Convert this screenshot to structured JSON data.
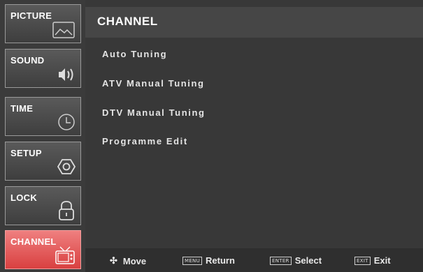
{
  "sidebar": {
    "tabs": [
      {
        "label": "PICTURE",
        "icon": "picture-icon",
        "active": false
      },
      {
        "label": "SOUND",
        "icon": "speaker-icon",
        "active": false
      },
      {
        "label": "TIME",
        "icon": "clock-icon",
        "active": false
      },
      {
        "label": "SETUP",
        "icon": "gear-icon",
        "active": false
      },
      {
        "label": "LOCK",
        "icon": "lock-icon",
        "active": false
      },
      {
        "label": "CHANNEL",
        "icon": "tv-icon",
        "active": true
      }
    ]
  },
  "main": {
    "title": "CHANNEL",
    "items": [
      {
        "label": "Auto Tuning"
      },
      {
        "label": "ATV Manual Tuning"
      },
      {
        "label": "DTV Manual Tuning"
      },
      {
        "label": "Programme Edit"
      }
    ]
  },
  "footer": {
    "move": {
      "label": "Move"
    },
    "return": {
      "key": "MENU",
      "label": "Return"
    },
    "select": {
      "key": "ENTER",
      "label": "Select"
    },
    "exit": {
      "key": "EXIT",
      "label": "Exit"
    }
  },
  "colors": {
    "active_tab": "#d94040",
    "background": "#383838",
    "text": "#ffffff"
  }
}
